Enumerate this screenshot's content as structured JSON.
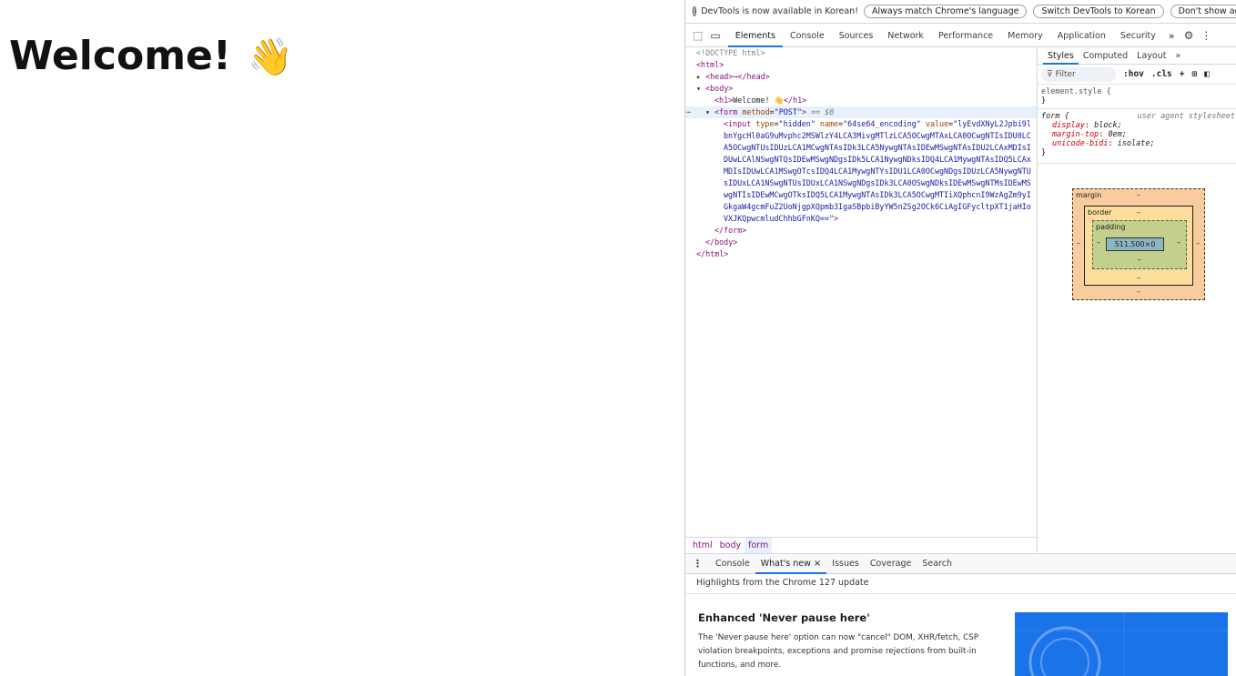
{
  "page": {
    "heading": "Welcome!",
    "heading_emoji": "👋"
  },
  "devtools": {
    "infobar": {
      "icon": "info-icon",
      "message": "DevTools is now available in Korean!",
      "buttons": [
        "Always match Chrome's language",
        "Switch DevTools to Korean",
        "Don't show again"
      ],
      "close": "×"
    },
    "toolbar": {
      "tabs": [
        "Elements",
        "Console",
        "Sources",
        "Network",
        "Performance",
        "Memory",
        "Application",
        "Security"
      ],
      "active_tab": "Elements",
      "more": "»"
    },
    "elements_tree": {
      "doctype": "<!DOCTYPE html>",
      "html_open": "<html>",
      "head": "<head>",
      "head_ellipsis": "⋯",
      "head_close": "</head>",
      "body_open": "<body>",
      "h1_open": "<h1>",
      "h1_text": "Welcome! 👋",
      "h1_close": "</h1>",
      "form_tag": "form",
      "form_attr_name": "method",
      "form_attr_value": "\"POST\"",
      "form_suffix": "== $0",
      "input_tag": "input",
      "input_attrs": [
        {
          "name": "type",
          "value": "\"hidden\""
        },
        {
          "name": "name",
          "value": "\"64se64_encoding\""
        },
        {
          "name": "value",
          "value": "\"lyEvdXNyL2Jpbi9lbnYgcHl0aG9uMvphc2MSWlzY4LCA3MivgMTlzLCA5OCwgMTAxLCA0OCwgNTIsIDU0LCA5OCwgNTUsIDUzLCA1MCwgNTAsIDk3LCA5NywgNTAsIDEwMSwgNTAsIDU2LCAxMDIsIDUwLCAlNSwgNTQsIDEwMSwgNDgsIDk5LCA1NywgNDksIDQ4LCA1MywgNTAsIDQ5LCAxMDIsIDUwLCA1MSwgOTcsIDQ4LCA1MywgNTYsIDU1LCA0OCwgNDgsIDUzLCA5NywgNTUsIDUxLCA1NSwgNTUsIDUxLCA1NSwgNDgsIDk3LCA0OSwgNDksIDEwMSwgNTMsIDEwMSwgNTIsIDEwMCwgOTksIDQ5LCA1MywgNTAsIDk3LCA5OCwgMTIiXQphcnI9WzAgZm9yIGkgaW4gcmFuZ2UoNjgpXQpmb3IgaSBpbiByYW5nZSg2OCk6CiAgIGFycltpXT1jaHIoVXJKQpwcmludChhbGFnKQ==\""
        }
      ],
      "form_close": "</form>",
      "body_close": "</body>",
      "html_close": "</html>",
      "selected_marker": "⋯"
    },
    "styles_pane": {
      "tabs": [
        "Styles",
        "Computed",
        "Layout"
      ],
      "active_tab": "Styles",
      "more": "»",
      "filter_placeholder": "Filter",
      "filter_buttons": [
        ":hov",
        ".cls",
        "+"
      ],
      "element_style": "element.style {",
      "element_style_close": "}",
      "rule_selector": "form {",
      "rule_source": "user agent stylesheet",
      "rule_props": [
        {
          "prop": "display",
          "value": "block;"
        },
        {
          "prop": "margin-top",
          "value": "0em;"
        },
        {
          "prop": "unicode-bidi",
          "value": "isolate;"
        }
      ],
      "rule_close": "}"
    },
    "box_model": {
      "margin_label": "margin",
      "border_label": "border",
      "padding_label": "padding",
      "content": "511.500×0",
      "dash": "–"
    },
    "breadcrumbs": [
      "html",
      "body",
      "form"
    ],
    "active_breadcrumb": "form",
    "drawer": {
      "tabs": [
        "Console",
        "What's new",
        "Issues",
        "Coverage",
        "Search"
      ],
      "active_tab": "What's new",
      "close": "×",
      "highlights": "Highlights from the Chrome 127 update",
      "feature_title": "Enhanced 'Never pause here'",
      "feature_desc": "The 'Never pause here' option can now \"cancel\" DOM, XHR/fetch, CSP violation breakpoints, exceptions and promise rejections from built-in functions, and more."
    }
  }
}
